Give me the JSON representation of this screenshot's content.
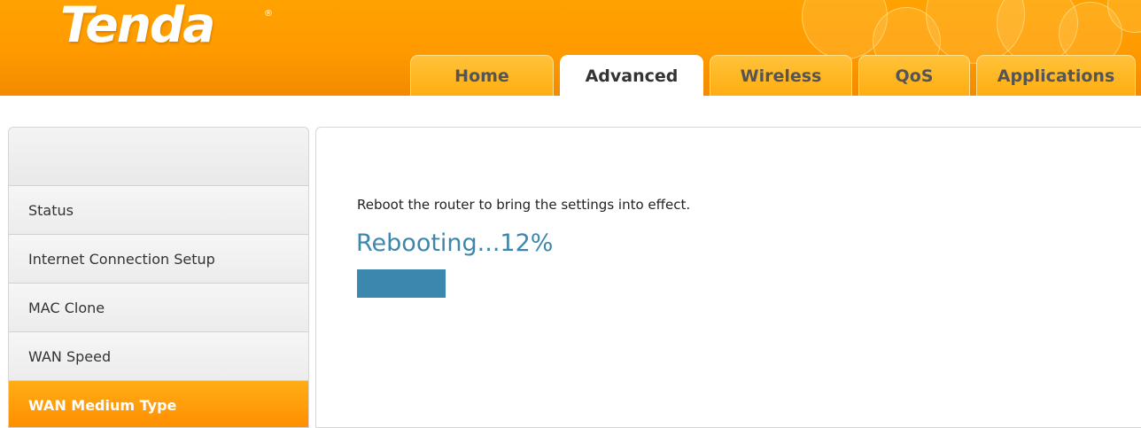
{
  "brand": {
    "logo_text": "Tenda",
    "registered_mark": "®",
    "colors": {
      "header": "#ff9a00",
      "accent": "#ff9a00",
      "progress": "#3b87ad"
    }
  },
  "nav": {
    "tabs": [
      {
        "label": "Home",
        "active": false
      },
      {
        "label": "Advanced",
        "active": true
      },
      {
        "label": "Wireless",
        "active": false
      },
      {
        "label": "QoS",
        "active": false
      },
      {
        "label": "Applications",
        "active": false
      }
    ]
  },
  "sidebar": {
    "items": [
      {
        "label": "Status",
        "active": false
      },
      {
        "label": "Internet Connection Setup",
        "active": false
      },
      {
        "label": "MAC Clone",
        "active": false
      },
      {
        "label": "WAN Speed",
        "active": false
      },
      {
        "label": "WAN Medium Type",
        "active": true
      }
    ]
  },
  "reboot": {
    "message": "Reboot the router to bring the settings into effect.",
    "status_text": "Rebooting...12%",
    "progress_percent": 12
  }
}
